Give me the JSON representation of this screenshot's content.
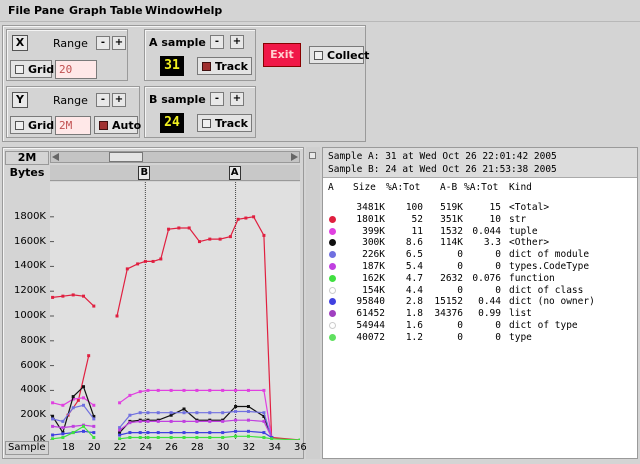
{
  "menu": [
    "File",
    "Pane",
    "Graph",
    "Table",
    "Window",
    "Help"
  ],
  "x_panel": {
    "axis": "X",
    "range_label": "Range",
    "minus": "-",
    "plus": "+",
    "grid_label": "Grid",
    "range_value": "20"
  },
  "y_panel": {
    "axis": "Y",
    "range_label": "Range",
    "minus": "-",
    "plus": "+",
    "grid_label": "Grid",
    "range_value": "2M",
    "auto_label": "Auto"
  },
  "a_sample": {
    "label": "A sample",
    "minus": "-",
    "plus": "+",
    "value": "31",
    "track_label": "Track"
  },
  "b_sample": {
    "label": "B sample",
    "minus": "-",
    "plus": "+",
    "value": "24",
    "track_label": "Track"
  },
  "exit_label": "Exit",
  "collect_label": "Collect",
  "graph": {
    "y_scale": "2M",
    "y_unit": "Bytes",
    "x_unit": "Sample",
    "marker_a": "A",
    "marker_b": "B"
  },
  "info": {
    "sample_a": "Sample A: 31 at Wed Oct 26 22:01:42 2005",
    "sample_b": "Sample B: 24 at Wed Oct 26 21:53:38 2005"
  },
  "table": {
    "headers": [
      "A",
      "Size",
      "%A:Tot",
      "A-B",
      "%A:Tot",
      "Kind"
    ],
    "rows": [
      {
        "color": "",
        "size": "3481K",
        "pct": "100",
        "ab": "519K",
        "pct2": "15",
        "kind": "<Total>"
      },
      {
        "color": "#e02040",
        "size": "1801K",
        "pct": "52",
        "ab": "351K",
        "pct2": "10",
        "kind": "str"
      },
      {
        "color": "#e040e0",
        "size": "399K",
        "pct": "11",
        "ab": "1532",
        "pct2": "0.044",
        "kind": "tuple"
      },
      {
        "color": "#101010",
        "size": "300K",
        "pct": "8.6",
        "ab": "114K",
        "pct2": "3.3",
        "kind": "<Other>"
      },
      {
        "color": "#7070e0",
        "size": "226K",
        "pct": "6.5",
        "ab": "0",
        "pct2": "0",
        "kind": "dict of module"
      },
      {
        "color": "#c040e0",
        "size": "187K",
        "pct": "5.4",
        "ab": "0",
        "pct2": "0",
        "kind": "types.CodeType"
      },
      {
        "color": "#40e040",
        "size": "162K",
        "pct": "4.7",
        "ab": "2632",
        "pct2": "0.076",
        "kind": "function"
      },
      {
        "color": "#ffffff",
        "size": "154K",
        "pct": "4.4",
        "ab": "0",
        "pct2": "0",
        "kind": "dict of class"
      },
      {
        "color": "#4040e0",
        "size": "95840",
        "pct": "2.8",
        "ab": "15152",
        "pct2": "0.44",
        "kind": "dict (no owner)"
      },
      {
        "color": "#a040c0",
        "size": "61452",
        "pct": "1.8",
        "ab": "34376",
        "pct2": "0.99",
        "kind": "list"
      },
      {
        "color": "#ffffff",
        "size": "54944",
        "pct": "1.6",
        "ab": "0",
        "pct2": "0",
        "kind": "dict of type"
      },
      {
        "color": "#60e060",
        "size": "40072",
        "pct": "1.2",
        "ab": "0",
        "pct2": "0",
        "kind": "type"
      }
    ]
  },
  "chart_data": {
    "type": "line",
    "xlim": [
      16.6,
      36
    ],
    "ylim": [
      0,
      2000
    ],
    "x_ticks": [
      "18",
      "20",
      "22",
      "24",
      "26",
      "28",
      "30",
      "32",
      "34",
      "36"
    ],
    "y_ticks": [
      "0K",
      "200K",
      "400K",
      "600K",
      "800K",
      "1000K",
      "1200K",
      "1400K",
      "1600K",
      "1800K"
    ],
    "marker_b_x": 24,
    "marker_a_x": 31,
    "series": [
      {
        "color": "#e02040",
        "segments": [
          [
            [
              16.8,
              1150
            ],
            [
              17.6,
              1160
            ],
            [
              18.4,
              1170
            ],
            [
              19.2,
              1160
            ],
            [
              20,
              1080
            ]
          ],
          [
            [
              21.8,
              1000
            ],
            [
              22.6,
              1380
            ],
            [
              23.4,
              1420
            ],
            [
              24,
              1440
            ],
            [
              24.6,
              1440
            ],
            [
              25.2,
              1460
            ],
            [
              25.8,
              1700
            ],
            [
              26.6,
              1710
            ],
            [
              27.4,
              1710
            ],
            [
              28.2,
              1600
            ],
            [
              29,
              1620
            ],
            [
              29.8,
              1620
            ],
            [
              30.6,
              1640
            ],
            [
              31.2,
              1780
            ],
            [
              31.8,
              1790
            ],
            [
              32.4,
              1800
            ],
            [
              33.2,
              1650
            ],
            [
              33.8,
              20
            ],
            [
              36,
              0
            ]
          ],
          [
            [
              18,
              200
            ],
            [
              18.8,
              320
            ],
            [
              19.6,
              680
            ]
          ]
        ]
      },
      {
        "color": "#e040e0",
        "segments": [
          [
            [
              16.8,
              300
            ],
            [
              17.6,
              280
            ],
            [
              18.4,
              330
            ],
            [
              19.2,
              340
            ],
            [
              20,
              280
            ]
          ],
          [
            [
              22,
              300
            ],
            [
              22.8,
              360
            ],
            [
              23.6,
              390
            ],
            [
              24.2,
              400
            ],
            [
              25,
              400
            ],
            [
              26,
              400
            ],
            [
              27,
              400
            ],
            [
              28,
              400
            ],
            [
              29,
              400
            ],
            [
              30,
              400
            ],
            [
              31,
              400
            ],
            [
              32,
              400
            ],
            [
              33.2,
              400
            ],
            [
              33.8,
              20
            ]
          ]
        ]
      },
      {
        "color": "#101010",
        "segments": [
          [
            [
              16.8,
              190
            ],
            [
              17.6,
              60
            ],
            [
              18.4,
              350
            ],
            [
              19.2,
              430
            ],
            [
              20,
              190
            ]
          ],
          [
            [
              22,
              60
            ],
            [
              22.8,
              150
            ],
            [
              23.6,
              160
            ],
            [
              24.2,
              160
            ],
            [
              25,
              160
            ],
            [
              26,
              200
            ],
            [
              27,
              250
            ],
            [
              28,
              160
            ],
            [
              29,
              160
            ],
            [
              30,
              160
            ],
            [
              31,
              270
            ],
            [
              32,
              270
            ],
            [
              33.2,
              190
            ],
            [
              33.8,
              20
            ]
          ]
        ]
      },
      {
        "color": "#7070e0",
        "segments": [
          [
            [
              16.8,
              170
            ],
            [
              17.6,
              150
            ],
            [
              18.4,
              260
            ],
            [
              19.2,
              280
            ],
            [
              20,
              170
            ]
          ],
          [
            [
              22,
              100
            ],
            [
              22.8,
              200
            ],
            [
              23.6,
              220
            ],
            [
              24.2,
              220
            ],
            [
              25,
              220
            ],
            [
              26,
              220
            ],
            [
              27,
              220
            ],
            [
              28,
              220
            ],
            [
              29,
              220
            ],
            [
              30,
              220
            ],
            [
              31,
              230
            ],
            [
              32,
              230
            ],
            [
              33.2,
              220
            ],
            [
              33.8,
              20
            ]
          ]
        ]
      },
      {
        "color": "#c040e0",
        "segments": [
          [
            [
              16.8,
              110
            ],
            [
              17.6,
              100
            ],
            [
              18.4,
              110
            ],
            [
              19.2,
              120
            ],
            [
              20,
              110
            ]
          ],
          [
            [
              22,
              80
            ],
            [
              22.8,
              140
            ],
            [
              23.6,
              150
            ],
            [
              24.2,
              150
            ],
            [
              25,
              150
            ],
            [
              26,
              150
            ],
            [
              27,
              150
            ],
            [
              28,
              150
            ],
            [
              29,
              150
            ],
            [
              30,
              150
            ],
            [
              31,
              160
            ],
            [
              32,
              160
            ],
            [
              33.2,
              150
            ],
            [
              33.8,
              20
            ]
          ]
        ]
      },
      {
        "color": "#4040e0",
        "segments": [
          [
            [
              16.8,
              40
            ],
            [
              17.6,
              50
            ],
            [
              18.4,
              60
            ],
            [
              19.2,
              70
            ],
            [
              20,
              60
            ]
          ],
          [
            [
              22,
              40
            ],
            [
              22.8,
              60
            ],
            [
              23.6,
              60
            ],
            [
              24.2,
              60
            ],
            [
              25,
              60
            ],
            [
              26,
              60
            ],
            [
              27,
              60
            ],
            [
              28,
              60
            ],
            [
              29,
              60
            ],
            [
              30,
              60
            ],
            [
              31,
              70
            ],
            [
              32,
              70
            ],
            [
              33.2,
              60
            ],
            [
              33.8,
              20
            ]
          ]
        ]
      },
      {
        "color": "#40e040",
        "segments": [
          [
            [
              16.8,
              10
            ],
            [
              17.6,
              20
            ],
            [
              18.4,
              60
            ],
            [
              19.2,
              110
            ],
            [
              20,
              20
            ]
          ],
          [
            [
              22,
              10
            ],
            [
              22.8,
              20
            ],
            [
              23.6,
              20
            ],
            [
              24.2,
              20
            ],
            [
              25,
              20
            ],
            [
              26,
              20
            ],
            [
              27,
              20
            ],
            [
              28,
              20
            ],
            [
              29,
              20
            ],
            [
              30,
              20
            ],
            [
              31,
              30
            ],
            [
              32,
              30
            ],
            [
              33.2,
              20
            ],
            [
              33.8,
              10
            ],
            [
              36,
              0
            ]
          ]
        ]
      }
    ]
  }
}
